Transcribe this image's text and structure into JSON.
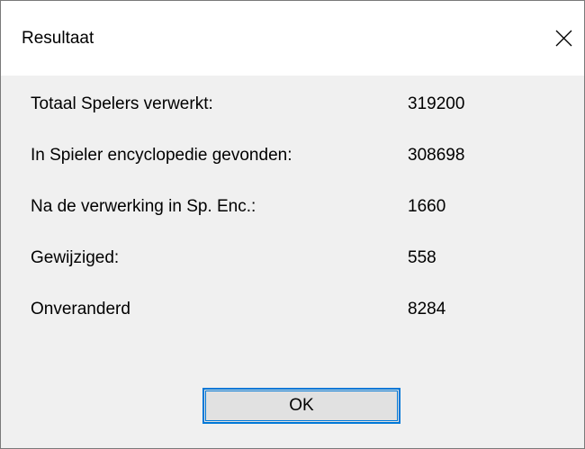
{
  "window": {
    "title": "Resultaat",
    "close_icon": "close-icon"
  },
  "stats": [
    {
      "label": "Totaal Spelers verwerkt:",
      "value": "319200"
    },
    {
      "label": "In Spieler encyclopedie gevonden:",
      "value": "308698"
    },
    {
      "label": "Na de verwerking in Sp. Enc.:",
      "value": "1660"
    },
    {
      "label": "Gewijziged:",
      "value": "558"
    },
    {
      "label": "Onveranderd",
      "value": "8284"
    }
  ],
  "buttons": {
    "ok_label": "OK"
  },
  "colors": {
    "accent": "#0078d7",
    "dialog_background": "#f0f0f0",
    "titlebar_background": "#ffffff",
    "button_background": "#e1e1e1"
  }
}
